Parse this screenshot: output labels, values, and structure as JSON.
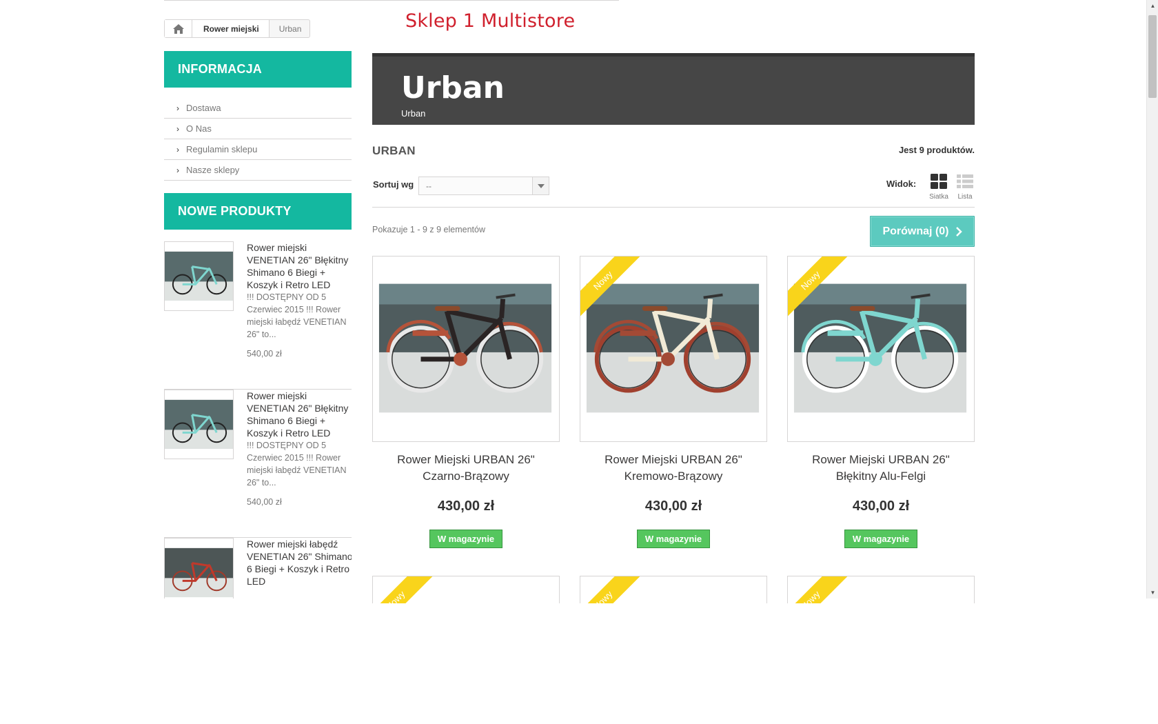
{
  "breadcrumb": {
    "home_icon": "home-icon",
    "item": "Rower miejski",
    "current": "Urban"
  },
  "store_title": "Sklep 1 Multistore",
  "sidebar": {
    "info_title": "INFORMACJA",
    "info_items": [
      {
        "label": "Dostawa"
      },
      {
        "label": "O Nas"
      },
      {
        "label": "Regulamin sklepu"
      },
      {
        "label": "Nasze sklepy"
      }
    ],
    "new_title": "NOWE PRODUKTY",
    "new_products": [
      {
        "name": "Rower miejski VENETIAN 26\" Błękitny Shimano 6 Biegi + Koszyk i Retro LED",
        "desc": "!!! DOSTĘPNY OD 5 Czerwiec 2015 !!! Rower miejski łabędź VENETIAN 26\" to...",
        "price": "540,00 zł"
      },
      {
        "name": "Rower miejski VENETIAN 26\" Błękitny Shimano 6 Biegi + Koszyk i Retro LED",
        "desc": "!!! DOSTĘPNY OD 5 Czerwiec 2015 !!! Rower miejski łabędź VENETIAN 26\" to...",
        "price": "540,00 zł"
      },
      {
        "name": "Rower miejski łabędź VENETIAN 26\" Shimano 6 Biegi + Koszyk i Retro LED",
        "desc": "",
        "price": ""
      }
    ]
  },
  "category": {
    "banner_title": "Urban",
    "banner_subtitle": "Urban",
    "name": "URBAN",
    "count": "Jest 9 produktów.",
    "sort_label": "Sortuj wg",
    "sort_value": "--",
    "view_label": "Widok:",
    "view_grid": "Siatka",
    "view_list": "Lista",
    "showing": "Pokazuje 1 - 9 z 9 elementów",
    "compare": "Porównaj (0)"
  },
  "products": [
    {
      "name": "Rower Miejski URBAN 26\" Czarno-Brązowy",
      "price": "430,00 zł",
      "stock": "W magazynie",
      "ribbon": "",
      "frame_color": "#2a2424",
      "fender_color": "#b5533a",
      "tire_color": "#e8e8e8"
    },
    {
      "name": "Rower Miejski URBAN 26\" Kremowo-Brązowy",
      "price": "430,00 zł",
      "stock": "W magazynie",
      "ribbon": "Nowy",
      "frame_color": "#f1ead6",
      "fender_color": "#a34a35",
      "tire_color": "#a0402e"
    },
    {
      "name": "Rower Miejski URBAN 26\" Błękitny Alu-Felgi",
      "price": "430,00 zł",
      "stock": "W magazynie",
      "ribbon": "Nowy",
      "frame_color": "#7fd6cf",
      "fender_color": "#7fd6cf",
      "tire_color": "#ffffff"
    }
  ],
  "products_row2": [
    {
      "ribbon": "Nowy"
    },
    {
      "ribbon": "Nowy"
    },
    {
      "ribbon": "Nowy"
    }
  ]
}
